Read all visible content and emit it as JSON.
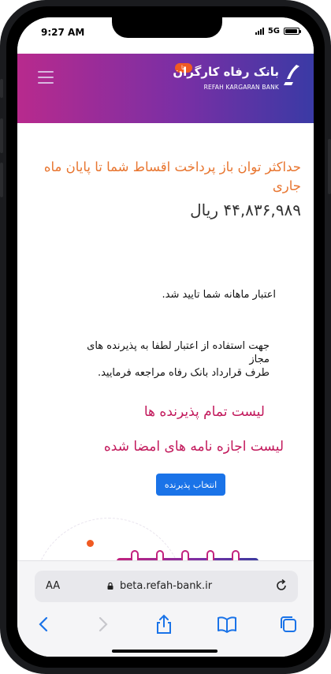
{
  "status": {
    "time": "9:27 AM",
    "network": "5G"
  },
  "header": {
    "brand_fa": "بانک رفاه کارگران",
    "brand_en": "REFAH KARGARAN BANK",
    "beta": "بتا"
  },
  "main": {
    "heading": "حداکثر توان باز پرداخت اقساط شما تا پایان ماه جاری",
    "amount": "۴۴,۸۳۶,۹۸۹ ریال",
    "approved_text": "اعتبار ماهانه شما تایید شد.",
    "guide_line1": "جهت استفاده از اعتبار لطفا به پذیرنده های مجاز",
    "guide_line2": "طرف قرارداد بانک رفاه مراجعه فرمایید.",
    "link_all_merchants": "لیست تمام پذیرنده ها",
    "link_signed_permits": "لیست اجازه نامه های امضا شده",
    "select_merchant_button": "انتخاب پذیرنده"
  },
  "browser": {
    "aa_label": "AA",
    "url": "beta.refah-bank.ir"
  },
  "colors": {
    "header_start": "#b82a8d",
    "header_end": "#3a3aa5",
    "heading": "#e8752f",
    "link": "#c2185b",
    "button": "#1a73e8",
    "safari_blue": "#1a73e8"
  }
}
